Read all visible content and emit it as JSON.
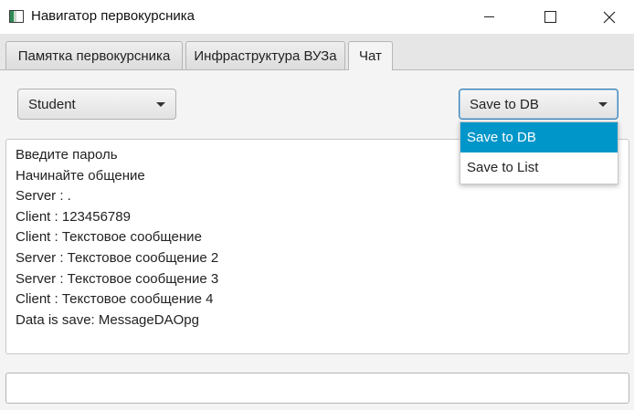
{
  "window": {
    "title": "Навигатор первокурсника"
  },
  "tabs": [
    {
      "label": "Памятка первокурсника"
    },
    {
      "label": "Инфраструктура ВУЗа"
    },
    {
      "label": "Чат"
    }
  ],
  "role_combo": {
    "value": "Student"
  },
  "save_combo": {
    "value": "Save to DB",
    "options": [
      {
        "label": "Save to DB",
        "selected": true
      },
      {
        "label": "Save to List",
        "selected": false
      }
    ]
  },
  "chat": {
    "lines": [
      "Введите пароль",
      "Начинайте общение",
      "Server : .",
      "Client : 123456789",
      "Client : Текстовое сообщение",
      "Server : Текстовое сообщение 2",
      "Server : Текстовое сообщение 3",
      "Client : Текстовое сообщение 4",
      "Data is save: MessageDAOpg"
    ]
  },
  "message_input": {
    "value": ""
  },
  "colors": {
    "selection": "#0096c9",
    "focus_border": "#3c7fb1"
  }
}
